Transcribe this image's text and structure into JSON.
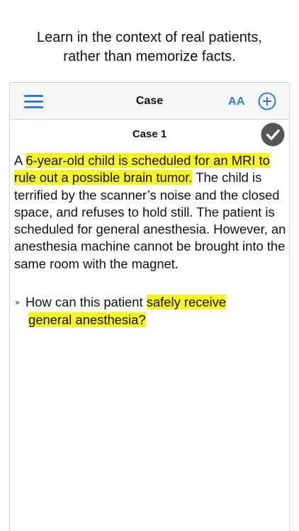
{
  "caption": {
    "line1": "Learn in the context of real patients,",
    "line2": "rather than memorize facts."
  },
  "navbar": {
    "title": "Case",
    "font_size_label": "AA",
    "icons": {
      "menu": "hamburger-menu-icon",
      "add": "add-circle-icon"
    },
    "accent_color": "#2b7de1"
  },
  "case": {
    "title": "Case 1",
    "status_icon": "checkmark-circle-icon",
    "text_prefix": "A ",
    "text_highlight": "6-year-old child is scheduled for an MRI to rule out a possible brain tumor.",
    "text_rest": " The child is terrified by the scanner’s noise and the closed space, and refuses to hold still. The patient is scheduled for general anesthesia. However, an anesthesia machine cannot be brought into the same room with the magnet.",
    "question_prefix": "How can this patient ",
    "question_highlight_1": "safely receive",
    "question_highlight_2": "general anesthesia?",
    "highlight_color": "#fbf51f"
  }
}
